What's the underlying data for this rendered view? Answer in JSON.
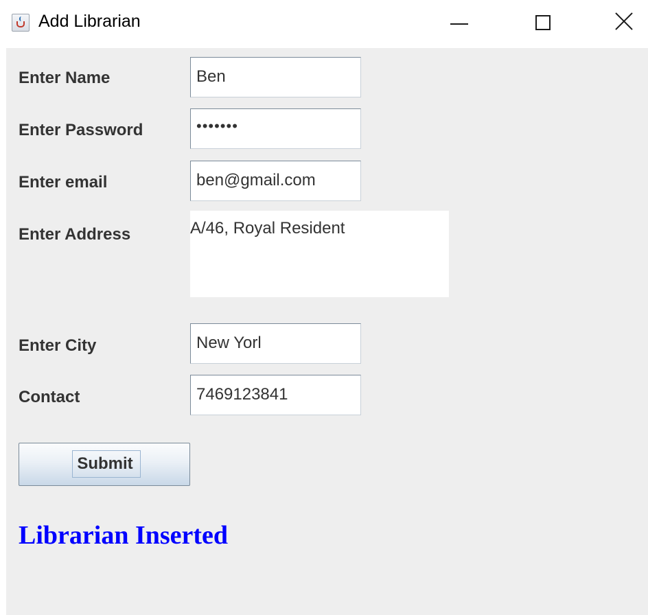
{
  "window": {
    "title": "Add Librarian",
    "app_icon": "java-cup-icon",
    "controls": {
      "minimize": "minimize-icon",
      "maximize": "maximize-icon",
      "close": "close-icon"
    }
  },
  "form": {
    "name": {
      "label": "Enter Name",
      "value": "Ben"
    },
    "password": {
      "label": "Enter Password",
      "value": "•••••••"
    },
    "email": {
      "label": "Enter email",
      "value": "ben@gmail.com"
    },
    "address": {
      "label": "Enter Address",
      "value": "A/46, Royal Resident"
    },
    "city": {
      "label": "Enter City",
      "value": "New Yorl"
    },
    "contact": {
      "label": "Contact",
      "value": "7469123841"
    },
    "submit_label": "Submit"
  },
  "status": {
    "message": "Librarian Inserted",
    "color": "#0000ff"
  },
  "colors": {
    "panel_background": "#eeeeee",
    "field_background": "#ffffff",
    "label_text": "#333333"
  }
}
